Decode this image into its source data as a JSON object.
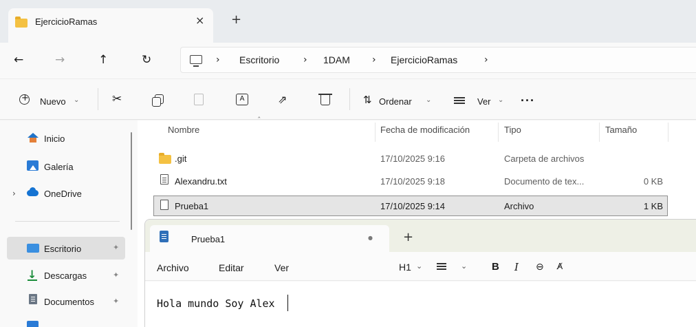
{
  "explorer": {
    "tab_title": "EjercicioRamas",
    "breadcrumbs": [
      "Escritorio",
      "1DAM",
      "EjercicioRamas"
    ],
    "toolbar": {
      "new_label": "Nuevo",
      "sort_label": "Ordenar",
      "view_label": "Ver",
      "more_label": "···"
    },
    "sidebar": {
      "items": [
        {
          "label": "Inicio",
          "icon": "home-icon"
        },
        {
          "label": "Galería",
          "icon": "gallery-icon"
        },
        {
          "label": "OneDrive",
          "icon": "cloud-icon"
        },
        {
          "label": "Escritorio",
          "icon": "desktop-icon"
        },
        {
          "label": "Descargas",
          "icon": "download-icon"
        },
        {
          "label": "Documentos",
          "icon": "document-icon"
        }
      ]
    },
    "columns": [
      "Nombre",
      "Fecha de modificación",
      "Tipo",
      "Tamaño"
    ],
    "files": [
      {
        "name": ".git",
        "date": "17/10/2025 9:16",
        "type": "Carpeta de archivos",
        "size": ""
      },
      {
        "name": "Alexandru.txt",
        "date": "17/10/2025 9:18",
        "type": "Documento de tex...",
        "size": "0 KB"
      },
      {
        "name": "Prueba1",
        "date": "17/10/2025 9:14",
        "type": "Archivo",
        "size": "1 KB"
      }
    ],
    "colors": {
      "accent": "#0067c0",
      "folder": "#f4c142",
      "selection": "#e5e5e5"
    }
  },
  "notepad": {
    "tab_title": "Prueba1",
    "unsaved_dot": "●",
    "new_tab": "+",
    "menu": [
      "Archivo",
      "Editar",
      "Ver"
    ],
    "format": {
      "heading": "H1",
      "bold": "B",
      "italic": "I"
    },
    "content": "Hola mundo Soy Alex"
  }
}
